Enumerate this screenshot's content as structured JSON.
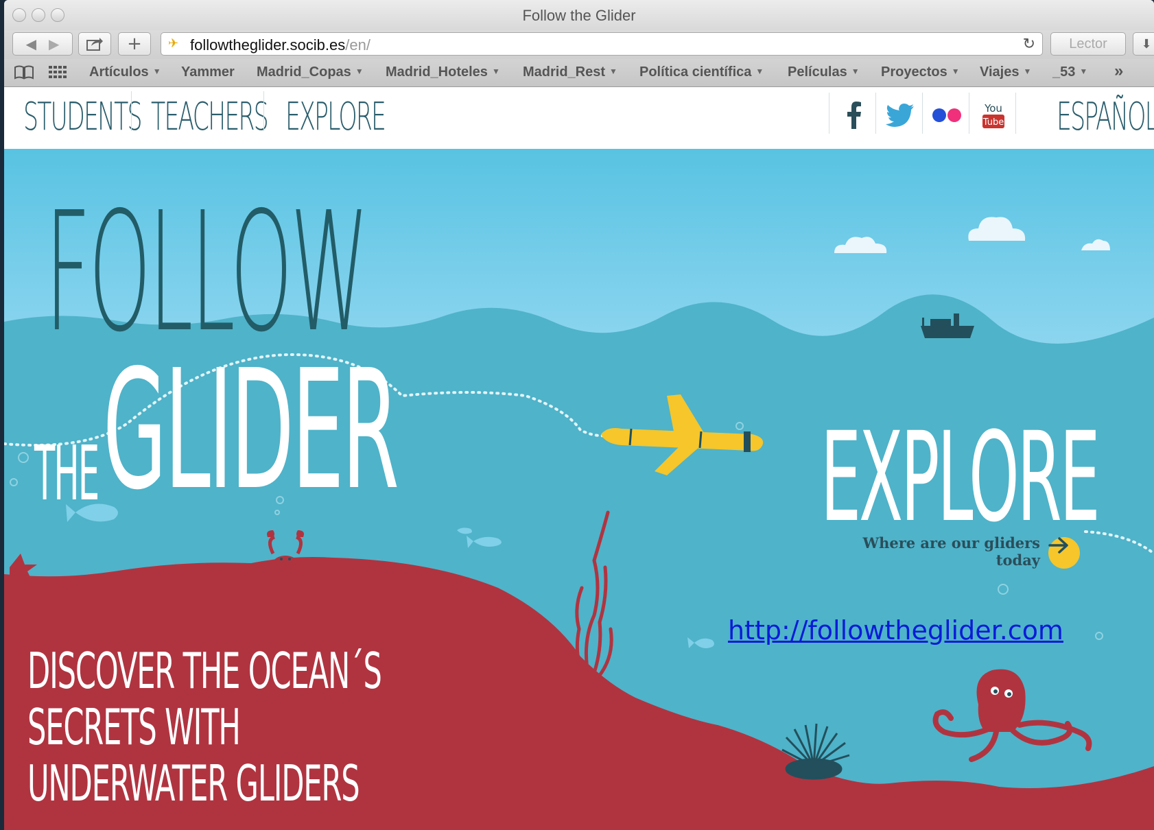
{
  "browser": {
    "window_title": "Follow the Glider",
    "url_host": "followtheglider.socib.es",
    "url_path": "/en/",
    "reader_label": "Lector",
    "bookmarks": [
      {
        "label": "Artículos",
        "has_menu": true
      },
      {
        "label": "Yammer",
        "has_menu": false
      },
      {
        "label": "Madrid_Copas",
        "has_menu": true
      },
      {
        "label": "Madrid_Hoteles",
        "has_menu": true
      },
      {
        "label": "Madrid_Rest",
        "has_menu": true
      },
      {
        "label": "Política científica",
        "has_menu": true
      },
      {
        "label": "Películas",
        "has_menu": true
      },
      {
        "label": "Proyectos",
        "has_menu": true
      },
      {
        "label": "Viajes",
        "has_menu": true
      },
      {
        "label": "_53",
        "has_menu": true
      }
    ],
    "overflow_label": "»"
  },
  "site": {
    "nav": [
      "STUDENTS",
      "TEACHERS",
      "EXPLORE"
    ],
    "language_link": "ESPAÑOL",
    "social": [
      "facebook-icon",
      "twitter-icon",
      "flickr-icon",
      "youtube-icon"
    ],
    "youtube_text_top": "You",
    "youtube_text_bottom": "Tube"
  },
  "hero": {
    "title_follow": "FOLLOW",
    "title_the": "THE",
    "title_glider": "GLIDER",
    "explore_heading": "EXPLORE",
    "explore_caption_line1": "Where are our gliders",
    "explore_caption_line2": "today",
    "link_text": "http://followtheglider.com",
    "tagline_line1": "DISCOVER THE OCEAN´S",
    "tagline_line2": "SECRETS WITH",
    "tagline_line3": "UNDERWATER GLIDERS"
  },
  "colors": {
    "sky_top": "#58c3e2",
    "sky_bottom": "#8fd6f0",
    "sea": "#4fb3c9",
    "seabed": "#b03440",
    "glider": "#f6c62a",
    "ink_dark": "#225c67"
  }
}
